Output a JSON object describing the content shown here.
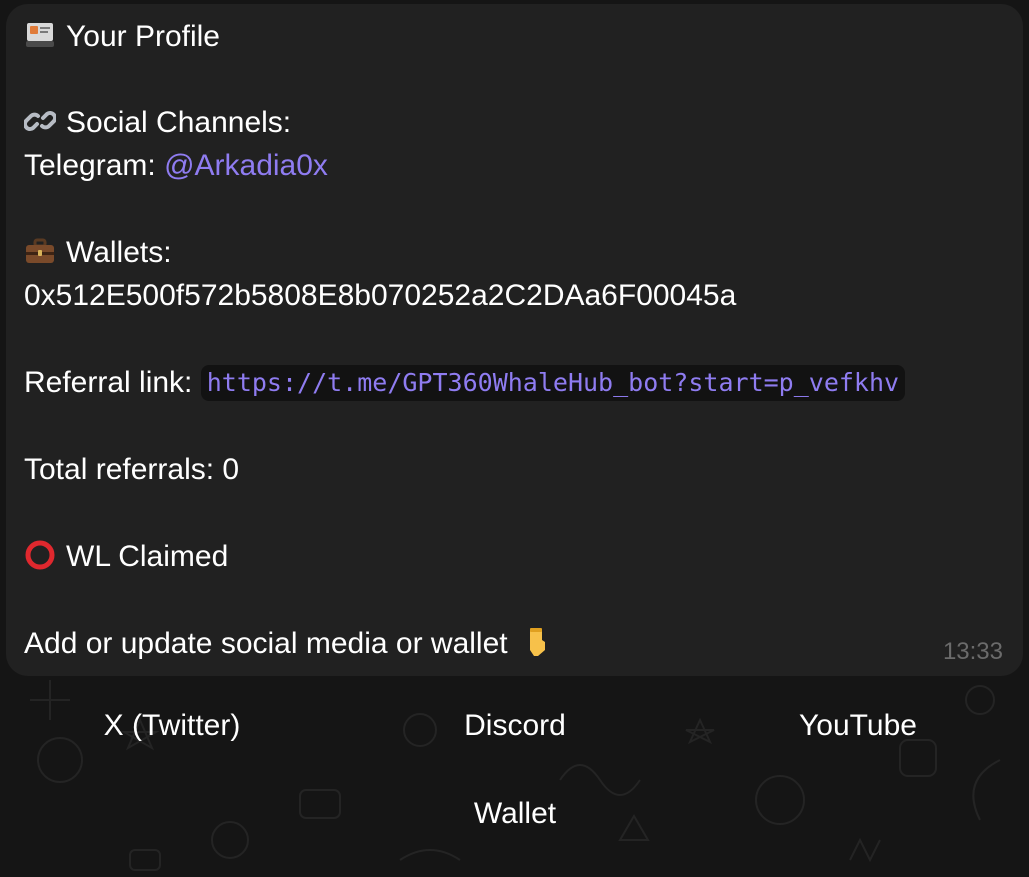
{
  "message": {
    "title": "Your Profile",
    "social_heading": "Social Channels:",
    "telegram_label": "Telegram: ",
    "telegram_handle": "@Arkadia0x",
    "wallets_heading": "Wallets:",
    "wallet_address": "0x512E500f572b5808E8b070252a2C2DAa6F00045a",
    "referral_label": "Referral link: ",
    "referral_link": "https://t.me/GPT360WhaleHub_bot?start=p_vefkhv",
    "total_referrals": "Total referrals: 0",
    "wl_status": "WL Claimed",
    "add_prompt": "Add or update social media or wallet",
    "time": "13:33"
  },
  "icons": {
    "title": "profile-card-icon",
    "social": "link-icon",
    "wallets": "briefcase-icon",
    "wl": "red-circle-icon",
    "prompt": "pointing-down-icon"
  },
  "keyboard": {
    "twitter": "X (Twitter)",
    "discord": "Discord",
    "youtube": "YouTube",
    "wallet": "Wallet"
  },
  "colors": {
    "bubble": "#212121",
    "link": "#8f7cf1",
    "code_background": "#121212",
    "timestamp": "#6b6b6b"
  }
}
